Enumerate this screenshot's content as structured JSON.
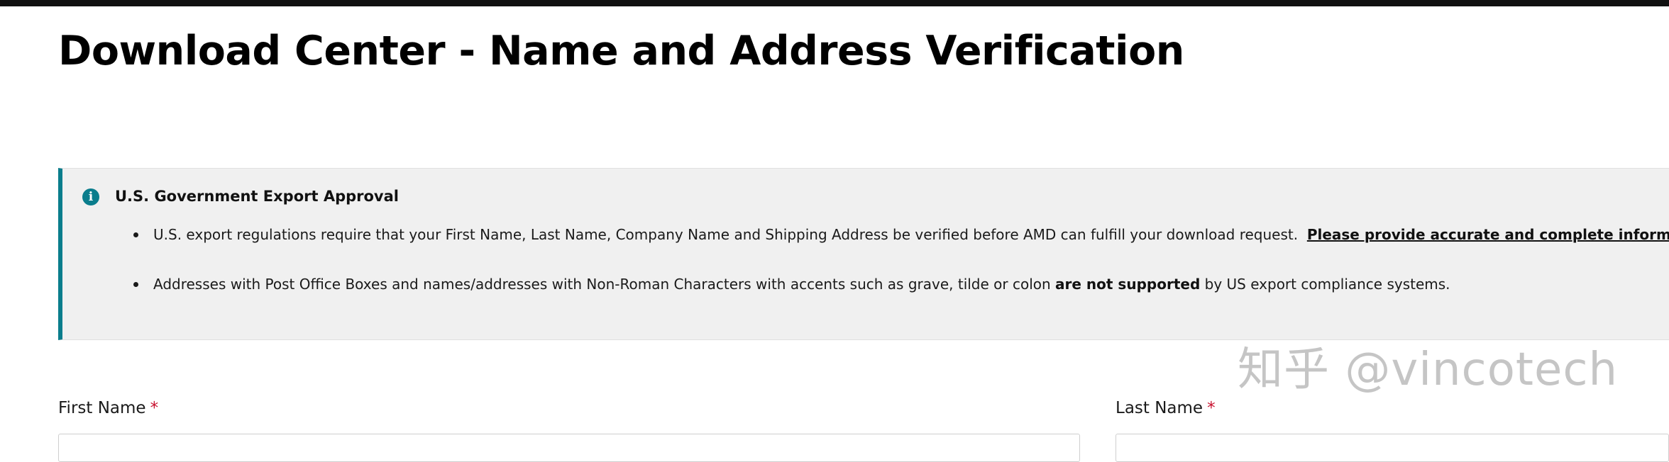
{
  "page": {
    "title": "Download Center - Name and Address Verification"
  },
  "notice": {
    "icon": "info-icon",
    "icon_glyph": "i",
    "title": "U.S. Government Export Approval",
    "bullet1": {
      "text": "U.S. export regulations require that your First Name, Last Name, Company Name and Shipping Address be verified before AMD can fulfill your download request.",
      "link": "Please provide accurate and complete information",
      "suffix": "."
    },
    "bullet2": {
      "text_before": "Addresses with Post Office Boxes and names/addresses with Non-Roman Characters with accents such as grave, tilde or colon",
      "bold": "are not supported",
      "text_after": "by US export compliance systems."
    }
  },
  "form": {
    "first_name_label": "First Name",
    "last_name_label": "Last Name",
    "required_marker": "*",
    "first_name_value": "",
    "last_name_value": ""
  },
  "watermark": "知乎 @vincotech",
  "colors": {
    "accent": "#0a7d8c",
    "required": "#c8102e",
    "notice_bg": "#f0f0f0"
  }
}
